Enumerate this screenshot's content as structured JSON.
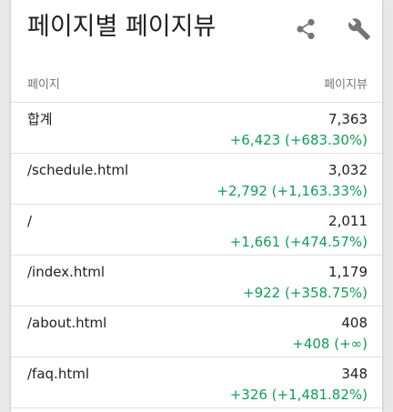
{
  "card": {
    "title": "페이지별 페이지뷰",
    "actions": {
      "share_icon": "share-icon",
      "settings_icon": "wrench-icon"
    }
  },
  "table": {
    "columns": {
      "page": "페이지",
      "views": "페이지뷰"
    },
    "rows": [
      {
        "page": "합계",
        "views": "7,363",
        "delta": "+6,423 (+683.30%)"
      },
      {
        "page": "/schedule.html",
        "views": "3,032",
        "delta": "+2,792 (+1,163.33%)"
      },
      {
        "page": "/",
        "views": "2,011",
        "delta": "+1,661 (+474.57%)"
      },
      {
        "page": "/index.html",
        "views": "1,179",
        "delta": "+922 (+358.75%)"
      },
      {
        "page": "/about.html",
        "views": "408",
        "delta": "+408 (+∞)"
      },
      {
        "page": "/faq.html",
        "views": "348",
        "delta": "+326 (+1,481.82%)"
      }
    ]
  },
  "colors": {
    "positive_delta": "#0f9d58",
    "icon": "#757575",
    "divider": "#e0e0e0"
  }
}
